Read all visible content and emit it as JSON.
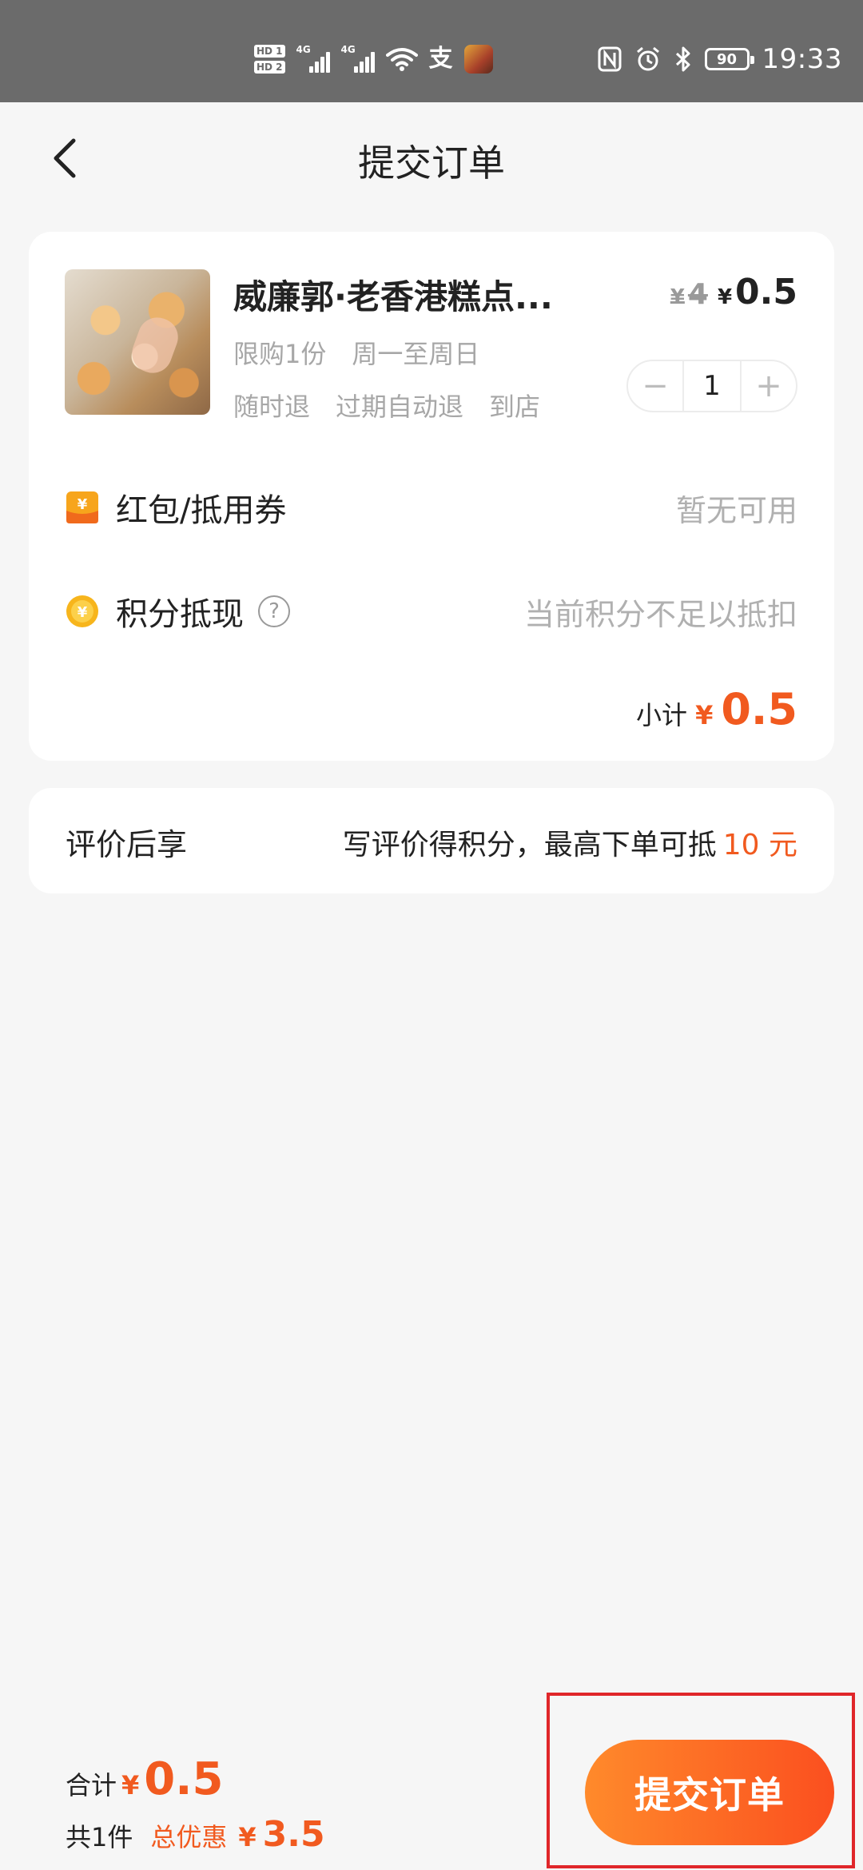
{
  "status_bar": {
    "sim1": "HD 1",
    "sim2": "HD 2",
    "network1": "4G",
    "network2": "4G",
    "alipay_glyph": "支",
    "battery": "90",
    "time": "19:33"
  },
  "header": {
    "title": "提交订单",
    "back_icon": "chevron-left-icon"
  },
  "product": {
    "name": "威廉郭·老香港糕点...",
    "original_price_symbol": "¥",
    "original_price": "4",
    "price_symbol": "¥",
    "price": "0.5",
    "tags_row1": [
      "限购1份",
      "周一至周日"
    ],
    "tags_row2": [
      "随时退",
      "过期自动退",
      "到店"
    ],
    "quantity": "1",
    "minus": "−",
    "plus": "+"
  },
  "coupon": {
    "icon": "red-packet-icon",
    "label": "红包/抵用券",
    "value": "暂无可用"
  },
  "points": {
    "icon": "coin-icon",
    "label": "积分抵现",
    "help": "?",
    "value": "当前积分不足以抵扣"
  },
  "subtotal": {
    "label": "小计",
    "symbol": "¥",
    "amount": "0.5"
  },
  "review": {
    "left": "评价后享",
    "right_text": "写评价得积分，最高下单可抵",
    "right_highlight": "10 元"
  },
  "footer": {
    "total_label": "合计",
    "total_symbol": "¥",
    "total_amount": "0.5",
    "count": "共1件",
    "discount_label": "总优惠",
    "discount_symbol": "¥",
    "discount_amount": "3.5",
    "submit_label": "提交订单"
  },
  "colors": {
    "accent": "#f15a1f",
    "button_start": "#ff8a2b",
    "button_end": "#fb4f1f",
    "highlight_box": "#e0262a",
    "status_bar": "#6b6b6b"
  }
}
